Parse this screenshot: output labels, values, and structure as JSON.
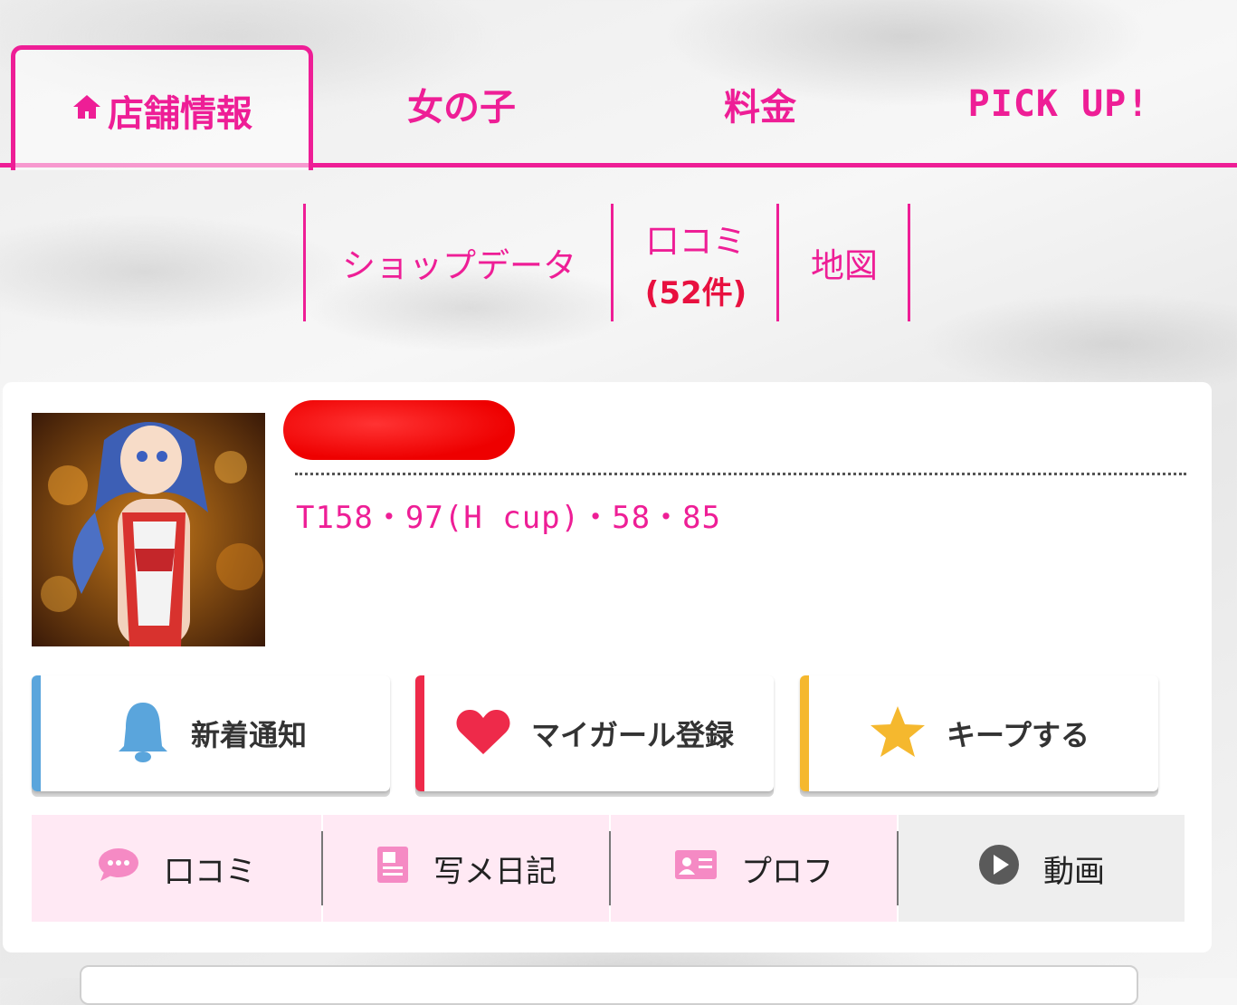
{
  "colors": {
    "accent": "#ee1e96",
    "count_red": "#e8103f",
    "notify_blue": "#5aa5dc",
    "heart_red": "#ee2a4a",
    "star_yellow": "#f5b82e",
    "gallery_pink": "#ffe9f4"
  },
  "top_tabs": [
    {
      "label": "店舗情報",
      "icon": "home-icon",
      "active": true
    },
    {
      "label": "女の子"
    },
    {
      "label": "料金"
    },
    {
      "label": "PICK UP!"
    }
  ],
  "sub_nav": {
    "shop_data": "ショップデータ",
    "reviews": "口コミ",
    "reviews_count": "(52件)",
    "map": "地図"
  },
  "profile": {
    "measurements": "T158・97(H cup)・58・85"
  },
  "actions": {
    "notify": {
      "label": "新着通知",
      "icon": "bell-icon"
    },
    "mygirl": {
      "label": "マイガール登録",
      "icon": "heart-icon"
    },
    "keep": {
      "label": "キープする",
      "icon": "star-icon"
    }
  },
  "content_tabs": [
    {
      "label": "口コミ",
      "icon": "chat-bubble-icon"
    },
    {
      "label": "写メ日記",
      "icon": "diary-icon"
    },
    {
      "label": "プロフ",
      "icon": "profile-card-icon"
    },
    {
      "label": "動画",
      "icon": "play-icon"
    }
  ]
}
